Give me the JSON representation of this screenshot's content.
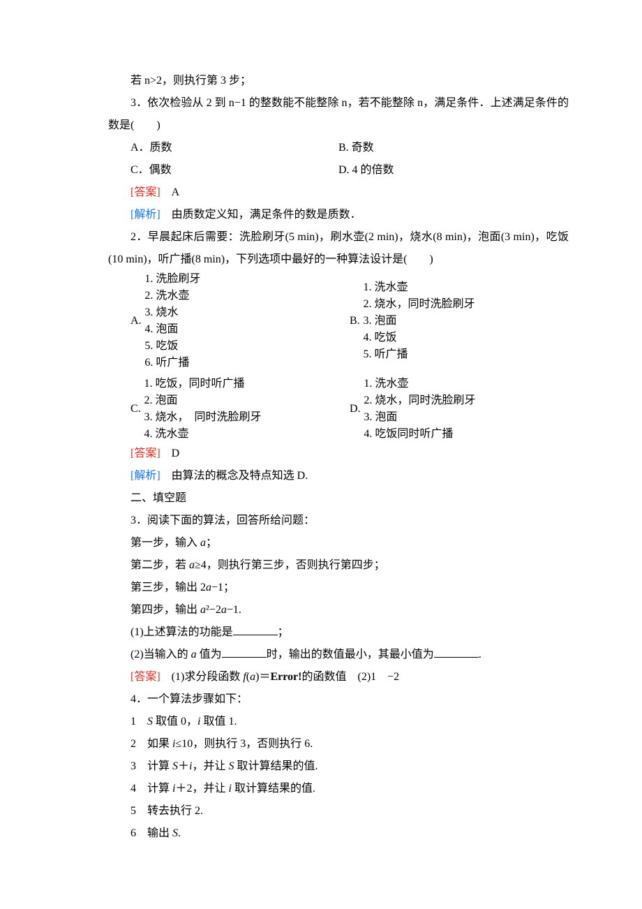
{
  "q1": {
    "pre_line": "若 n>2，则执行第 3 步；",
    "step3": "3．依次检验从 2 到 n−1 的整数能不能整除 n，若不能整除 n，满足条件．上述满足条件的数是(　　)",
    "A": "A．质数",
    "B": "B. 奇数",
    "C": "C．偶数",
    "D": "D. 4 的倍数",
    "ans_label": "[答案]",
    "ans": "　A",
    "exp_label": "[解析]",
    "exp": "　由质数定义知，满足条件的数是质数．"
  },
  "q2": {
    "stem": "2．早晨起床后需要：洗脸刷牙(5 min)，刷水壶(2 min)，烧水(8 min)，泡面(3 min)，吃饭(10 min)，听广播(8 min)，下列选项中最好的一种算法设计是(　　)",
    "A_label": "A.",
    "A_steps": "1. 洗脸刷牙\n2. 洗水壶\n3. 烧水\n4. 泡面\n5. 吃饭\n6. 听广播",
    "B_label": "B.",
    "B_steps": "1. 洗水壶\n2. 烧水，同时洗脸刷牙\n3. 泡面\n4. 吃饭\n5. 听广播",
    "C_label": "C.",
    "C_steps": "1. 吃饭，同时听广播\n2. 泡面\n3. 烧水，　同时洗脸刷牙\n4. 洗水壶",
    "D_label": "D.",
    "D_steps": "1. 洗水壶\n2. 烧水，同时洗脸刷牙\n3. 泡面\n4. 吃饭同时听广播",
    "ans_label": "[答案]",
    "ans": "　D",
    "exp_label": "[解析]",
    "exp": "　由算法的概念及特点知选 D."
  },
  "section2": "二、填空题",
  "q3": {
    "stem": "3．阅读下面的算法，回答所给问题：",
    "s1a": "第一步，输入 ",
    "s1b": "a",
    "s1c": "；",
    "s2a": "第二步，若 ",
    "s2b": "a",
    "s2c": "≥4，则执行第三步，否则执行第四步；",
    "s3a": "第三步，输出 2",
    "s3b": "a",
    "s3c": "−1；",
    "s4a": "第四步，输出 ",
    "s4b": "a",
    "s4c": "²−2",
    "s4d": "a",
    "s4e": "−1.",
    "b1a": "(1)上述算法的功能是",
    "b1b": "；",
    "b2a": "(2)当输入的 ",
    "b2b": "a",
    "b2c": " 值为",
    "b2d": "时，输出的数值最小，其最小值为",
    "b2e": ".",
    "ans_label": "[答案]",
    "ans_a": "　(1)求分段函数 ",
    "ans_b": "f",
    "ans_c": "(",
    "ans_d": "a",
    "ans_e": ")＝",
    "ans_err": "Error!",
    "ans_f": "的函数值　(2)1　−2"
  },
  "q4": {
    "stem": "4．一个算法步骤如下：",
    "s1a": "1　",
    "s1b": "S",
    "s1c": " 取值 0，",
    "s1d": "i",
    "s1e": " 取值 1.",
    "s2a": "2　如果 ",
    "s2b": "i",
    "s2c": "≤10，则执行 3，否则执行 6.",
    "s3a": "3　计算 ",
    "s3b": "S",
    "s3c": "＋",
    "s3d": "i",
    "s3e": "，并让 ",
    "s3f": "S",
    "s3g": " 取计算结果的值.",
    "s4a": "4　计算 ",
    "s4b": "i",
    "s4c": "＋2，并让 ",
    "s4d": "i",
    "s4e": " 取计算结果的值.",
    "s5": "5　转去执行 2.",
    "s6a": "6　输出 ",
    "s6b": "S",
    "s6c": "."
  }
}
